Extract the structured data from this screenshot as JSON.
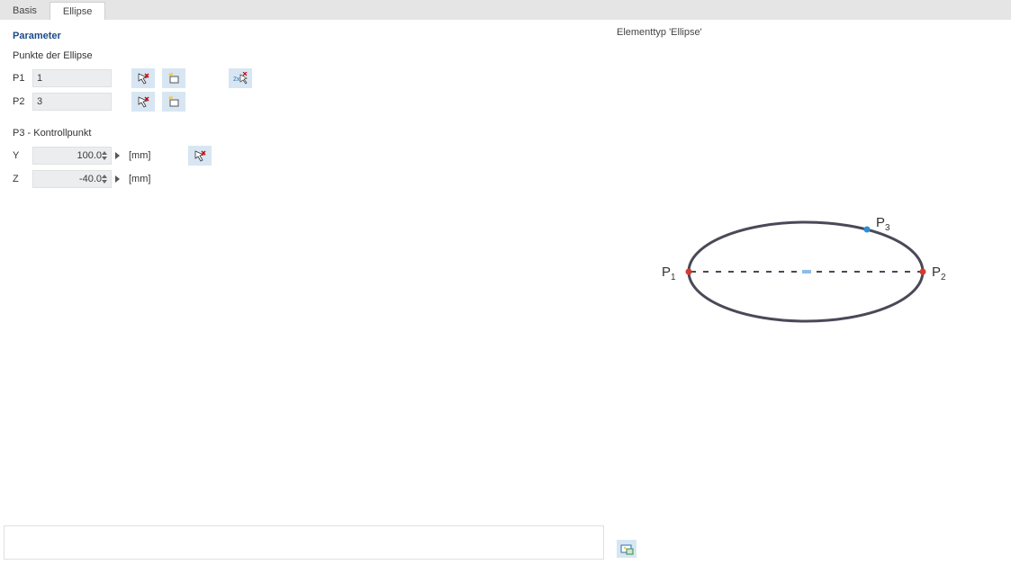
{
  "tabs": {
    "basis": "Basis",
    "ellipse": "Ellipse"
  },
  "left": {
    "title": "Parameter",
    "points_section": "Punkte der Ellipse",
    "p1_label": "P1",
    "p2_label": "P2",
    "p1_value": "1",
    "p2_value": "3",
    "control_section": "P3 - Kontrollpunkt",
    "y_label": "Y",
    "z_label": "Z",
    "y_value": "100.0",
    "z_value": "-40.0",
    "unit": "[mm]"
  },
  "right": {
    "title": "Elementtyp 'Ellipse'",
    "p1": "P",
    "p1s": "1",
    "p2": "P",
    "p2s": "2",
    "p3": "P",
    "p3s": "3"
  }
}
